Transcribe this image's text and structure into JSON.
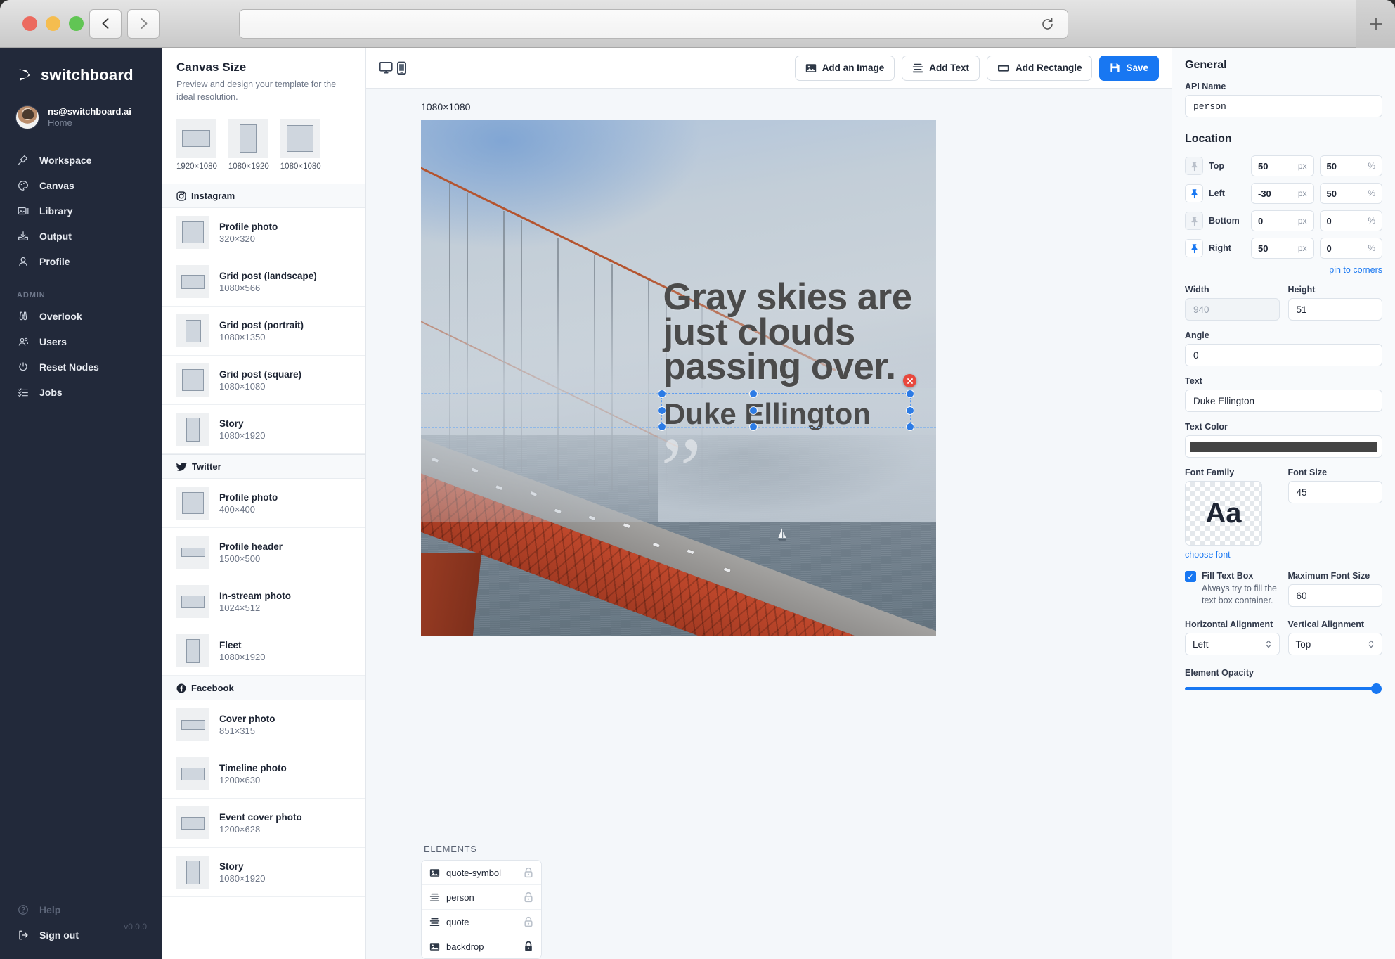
{
  "browser": {
    "back_icon": "chevron-left-icon",
    "forward_icon": "chevron-right-icon",
    "reload_icon": "reload-icon",
    "newtab_label": "+",
    "url_value": ""
  },
  "sidebar": {
    "brand": "switchboard",
    "account": {
      "email": "ns@switchboard.ai",
      "sub": "Home"
    },
    "items": [
      {
        "label": "Workspace",
        "icon": "workspace-icon"
      },
      {
        "label": "Canvas",
        "icon": "palette-icon"
      },
      {
        "label": "Library",
        "icon": "library-icon"
      },
      {
        "label": "Output",
        "icon": "output-icon"
      },
      {
        "label": "Profile",
        "icon": "person-icon"
      }
    ],
    "admin_label": "ADMIN",
    "admin_items": [
      {
        "label": "Overlook",
        "icon": "binoculars-icon"
      },
      {
        "label": "Users",
        "icon": "users-icon"
      },
      {
        "label": "Reset Nodes",
        "icon": "power-icon"
      },
      {
        "label": "Jobs",
        "icon": "list-check-icon"
      }
    ],
    "help_label": "Help",
    "signout_label": "Sign out",
    "version": "v0.0.0"
  },
  "sizes": {
    "title": "Canvas Size",
    "subtitle": "Preview and design your template for the ideal resolution.",
    "quick": [
      {
        "label": "1920×1080",
        "shape": "landscape"
      },
      {
        "label": "1080×1920",
        "shape": "portrait"
      },
      {
        "label": "1080×1080",
        "shape": "square"
      }
    ],
    "groups": [
      {
        "name": "Instagram",
        "icon": "instagram-icon",
        "presets": [
          {
            "name": "Profile photo",
            "dim": "320×320",
            "shape": "square"
          },
          {
            "name": "Grid post (landscape)",
            "dim": "1080×566",
            "shape": "landscape"
          },
          {
            "name": "Grid post (portrait)",
            "dim": "1080×1350",
            "shape": "portrait"
          },
          {
            "name": "Grid post (square)",
            "dim": "1080×1080",
            "shape": "square"
          },
          {
            "name": "Story",
            "dim": "1080×1920",
            "shape": "tall"
          }
        ]
      },
      {
        "name": "Twitter",
        "icon": "twitter-icon",
        "presets": [
          {
            "name": "Profile photo",
            "dim": "400×400",
            "shape": "square"
          },
          {
            "name": "Profile header",
            "dim": "1500×500",
            "shape": "wide"
          },
          {
            "name": "In-stream photo",
            "dim": "1024×512",
            "shape": "landscape"
          },
          {
            "name": "Fleet",
            "dim": "1080×1920",
            "shape": "tall"
          }
        ]
      },
      {
        "name": "Facebook",
        "icon": "facebook-icon",
        "presets": [
          {
            "name": "Cover photo",
            "dim": "851×315",
            "shape": "wide"
          },
          {
            "name": "Timeline photo",
            "dim": "1200×630",
            "shape": "landscape"
          },
          {
            "name": "Event cover photo",
            "dim": "1200×628",
            "shape": "landscape"
          },
          {
            "name": "Story",
            "dim": "1080×1920",
            "shape": "tall"
          }
        ]
      }
    ]
  },
  "toolbar": {
    "device_desktop_icon": "monitor-icon",
    "device_mobile_icon": "phone-icon",
    "add_image_label": "Add an Image",
    "add_image_icon": "image-icon",
    "add_text_label": "Add Text",
    "add_text_icon": "text-lines-icon",
    "add_rect_label": "Add Rectangle",
    "add_rect_icon": "rectangle-icon",
    "save_label": "Save",
    "save_icon": "save-icon"
  },
  "canvas": {
    "dimension_label": "1080×1080",
    "quote_line1": "Gray skies are",
    "quote_line2": "just clouds",
    "quote_line3": "passing over.",
    "person": "Duke Ellington",
    "quote_symbol": "”",
    "delete_icon": "close-icon"
  },
  "elements": {
    "title": "ELEMENTS",
    "layers": [
      {
        "name": "quote-symbol",
        "type_icon": "image-layer-icon",
        "locked": false
      },
      {
        "name": "person",
        "type_icon": "text-layer-icon",
        "locked": false
      },
      {
        "name": "quote",
        "type_icon": "text-layer-icon",
        "locked": false
      },
      {
        "name": "backdrop",
        "type_icon": "image-layer-icon",
        "locked": true
      }
    ]
  },
  "props": {
    "general_title": "General",
    "api_name_label": "API Name",
    "api_name_value": "person",
    "location_title": "Location",
    "location_rows": [
      {
        "name": "Top",
        "px": "50",
        "pct": "50",
        "pinned": false
      },
      {
        "name": "Left",
        "px": "-30",
        "pct": "50",
        "pinned": true
      },
      {
        "name": "Bottom",
        "px": "0",
        "pct": "0",
        "pinned": false
      },
      {
        "name": "Right",
        "px": "50",
        "pct": "0",
        "pinned": true
      }
    ],
    "unit_px": "px",
    "unit_pct": "%",
    "pin_to_corners": "pin to corners",
    "width_label": "Width",
    "width_value": "940",
    "height_label": "Height",
    "height_value": "51",
    "angle_label": "Angle",
    "angle_value": "0",
    "text_label": "Text",
    "text_value": "Duke Ellington",
    "text_color_label": "Text Color",
    "text_color_value": "#444444",
    "font_family_label": "Font Family",
    "font_preview_glyph": "Aa",
    "font_size_label": "Font Size",
    "font_size_value": "45",
    "choose_font": "choose font",
    "fill_text_box_label": "Fill Text Box",
    "fill_text_box_desc": "Always try to fill the text box container.",
    "fill_text_box_checked": true,
    "max_font_size_label": "Maximum Font Size",
    "max_font_size_value": "60",
    "h_align_label": "Horizontal Alignment",
    "h_align_value": "Left",
    "v_align_label": "Vertical Alignment",
    "v_align_value": "Top",
    "opacity_label": "Element Opacity",
    "opacity_value": 100
  },
  "colors": {
    "accent": "#1877f2",
    "sidebar_bg": "#22293a",
    "danger": "#e8483d"
  }
}
